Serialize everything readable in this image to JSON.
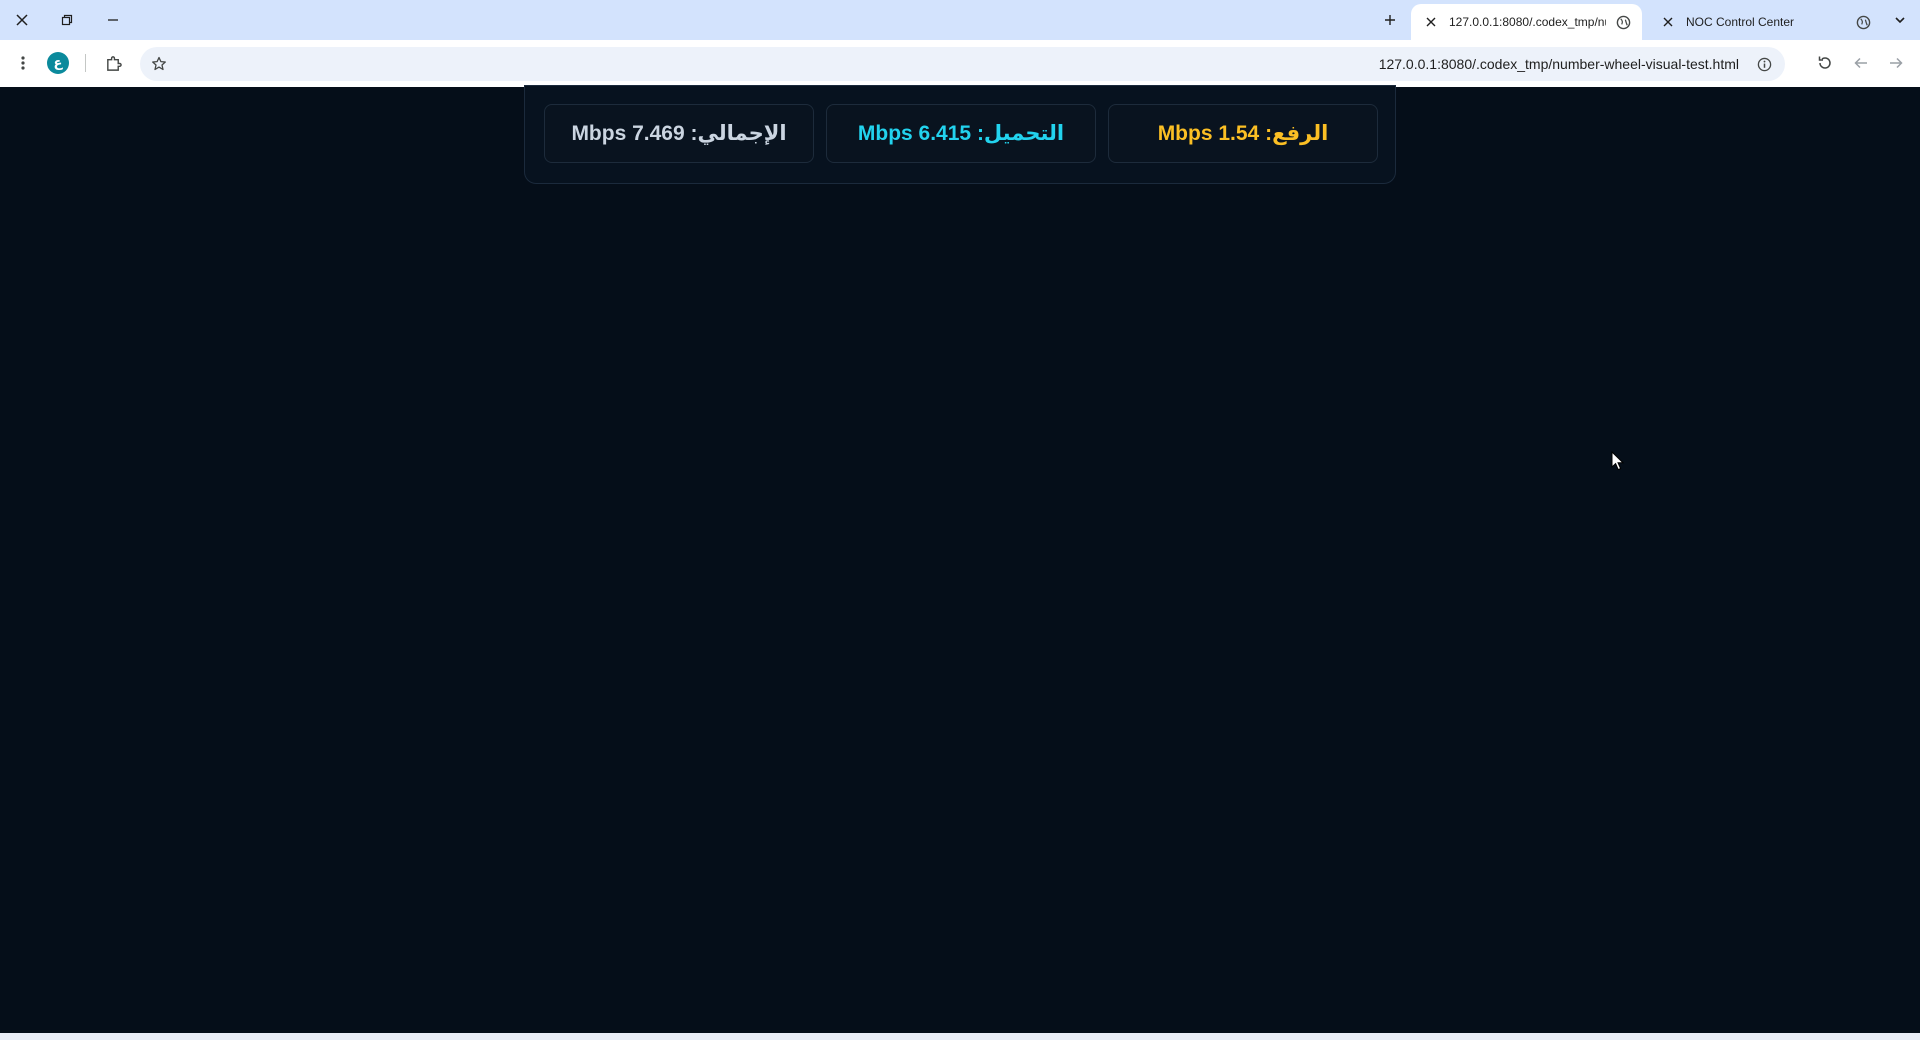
{
  "browser": {
    "tabs": [
      {
        "title": "127.0.0.1:8080/.codex_tmp/number-wheel-visual-test.html",
        "active": true,
        "favicon": "globe-icon"
      },
      {
        "title": "NOC Control Center",
        "active": false,
        "favicon": "globe-icon"
      }
    ],
    "url": "127.0.0.1:8080/.codex_tmp/number-wheel-visual-test.html",
    "profile_initial": "ع"
  },
  "stats": {
    "upload": {
      "label": "الرفع:",
      "value": "Mbps 1.54",
      "color": "#fbbf24"
    },
    "download": {
      "label": "التحميل:",
      "value": "Mbps 6.415",
      "color": "#22d3ee"
    },
    "total": {
      "label": "الإجمالي:",
      "value": "Mbps 7.469",
      "color": "#cbd5e1"
    }
  },
  "colors": {
    "page_background": "#050e19",
    "tabstrip": "#d3e3fd"
  }
}
